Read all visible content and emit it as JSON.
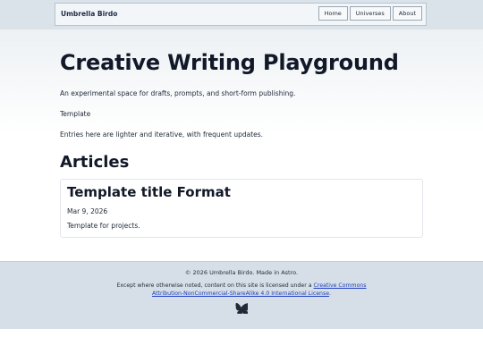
{
  "header": {
    "brand": "Umbrella Birdo",
    "nav": [
      "Home",
      "Universes",
      "About"
    ]
  },
  "main": {
    "title": "Creative Writing Playground",
    "intro": "An experimental space for drafts, prompts, and short-form publishing.",
    "template_label": "Template",
    "note": "Entries here are lighter and iterative, with frequent updates.",
    "articles_heading": "Articles",
    "articles": [
      {
        "title": "Template title Format",
        "date": "Mar 9, 2026",
        "description": "Template for projects."
      }
    ]
  },
  "footer": {
    "copyright": "© 2026 Umbrella Birdo. Made in Astro.",
    "license_prefix": "Except where otherwise noted, content on this site is licensed under a ",
    "license_link_1": "Creative Commons",
    "license_link_2": "Attribution-NonCommercial-ShareAlike 4.0 International License",
    "license_suffix": ".",
    "social_icon": "bluesky-butterfly-icon"
  },
  "colors": {
    "header_bg": "#dbe3ea",
    "footer_bg": "#d6dfe7",
    "link": "#1d3fbf",
    "text": "#1f2937"
  }
}
